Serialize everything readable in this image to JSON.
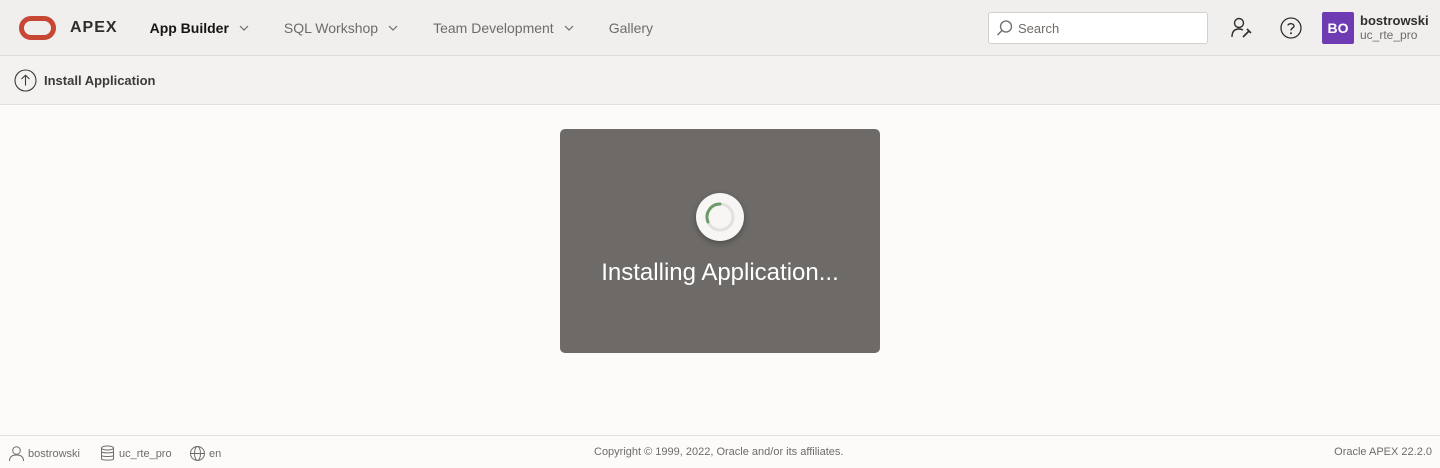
{
  "header": {
    "brand": "APEX",
    "nav": [
      {
        "label": "App Builder",
        "has_menu": true,
        "active": true
      },
      {
        "label": "SQL Workshop",
        "has_menu": true,
        "active": false
      },
      {
        "label": "Team Development",
        "has_menu": true,
        "active": false
      },
      {
        "label": "Gallery",
        "has_menu": false,
        "active": false
      }
    ],
    "search": {
      "placeholder": "Search",
      "value": ""
    },
    "icons": [
      "administration-icon",
      "help-icon"
    ],
    "user": {
      "initials": "BO",
      "name": "bostrowski",
      "workspace": "uc_rte_pro",
      "avatar_color": "#6e3bb2"
    }
  },
  "subheader": {
    "icon": "upload-icon",
    "title": "Install Application"
  },
  "loading": {
    "message": "Installing Application..."
  },
  "footer": {
    "user": "bostrowski",
    "workspace": "uc_rte_pro",
    "language": "en",
    "copyright": "Copyright © 1999, 2022, Oracle and/or its affiliates.",
    "version": "Oracle APEX 22.2.0"
  },
  "colors": {
    "brand_red": "#c74634",
    "overlay": "#6d6a67",
    "spinner_green": "#6e9a6a"
  }
}
